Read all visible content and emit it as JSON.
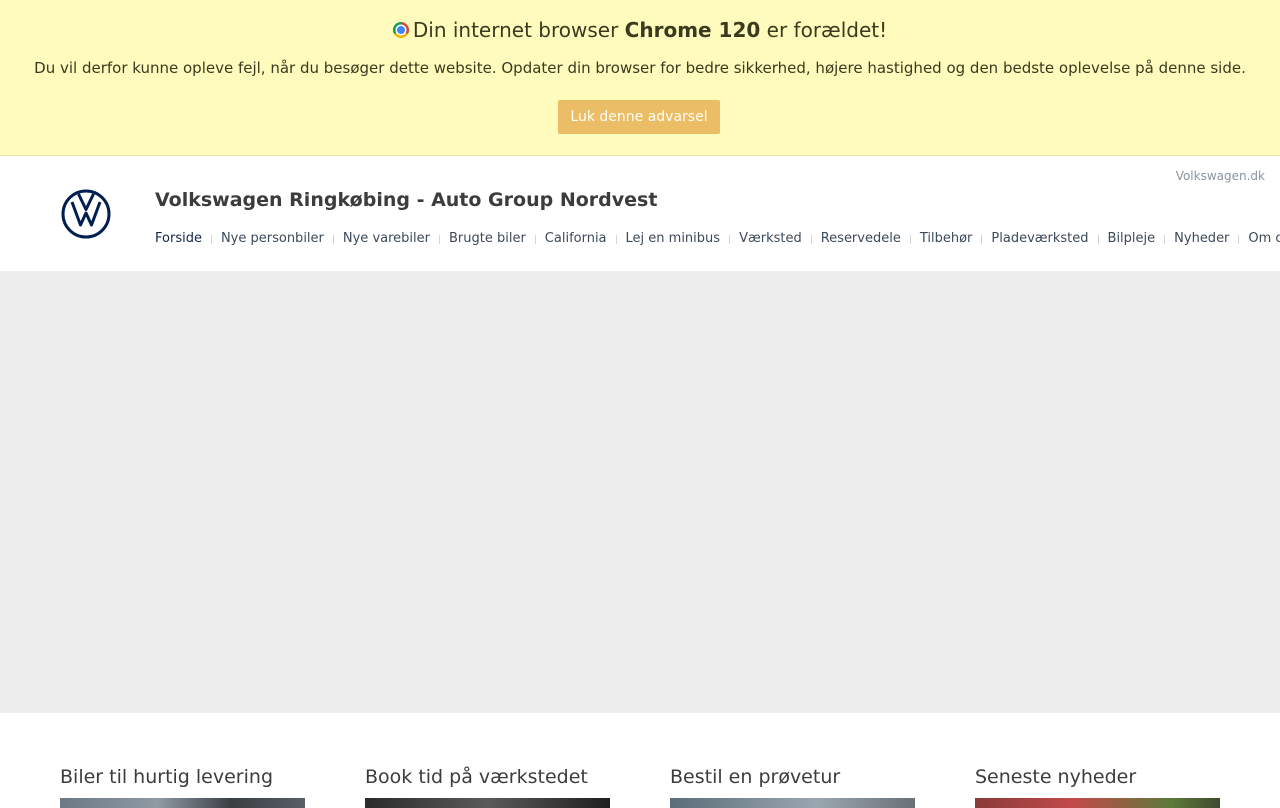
{
  "warning": {
    "title_prefix": "Din internet browser",
    "browser_name": "Chrome 120",
    "title_suffix": "er forældet!",
    "icon": "chrome-icon",
    "description": "Du vil derfor kunne opleve fejl, når du besøger dette website. Opdater din browser for bedre sikkerhed, højere hastighed og den bedste oplevelse på denne side.",
    "close_label": "Luk denne advarsel",
    "background_color": "#fffbbd",
    "button_color": "#ebbd66"
  },
  "header": {
    "logo": "vw-logo-icon",
    "brand_link": "Volkswagen.dk",
    "dealer_title": "Volkswagen Ringkøbing - Auto Group Nordvest",
    "brand_color": "#001e50"
  },
  "nav": {
    "items": [
      {
        "label": "Forside",
        "active": true
      },
      {
        "label": "Nye personbiler"
      },
      {
        "label": "Nye varebiler"
      },
      {
        "label": "Brugte biler"
      },
      {
        "label": "California"
      },
      {
        "label": "Lej en minibus"
      },
      {
        "label": "Værksted"
      },
      {
        "label": "Reservedele"
      },
      {
        "label": "Tilbehør"
      },
      {
        "label": "Pladeværksted"
      },
      {
        "label": "Bilpleje"
      },
      {
        "label": "Nyheder"
      },
      {
        "label": "Om os"
      }
    ]
  },
  "tiles": [
    {
      "title": "Biler til hurtig levering"
    },
    {
      "title": "Book tid på værkstedet"
    },
    {
      "title": "Bestil en prøvetur"
    },
    {
      "title": "Seneste nyheder"
    }
  ]
}
